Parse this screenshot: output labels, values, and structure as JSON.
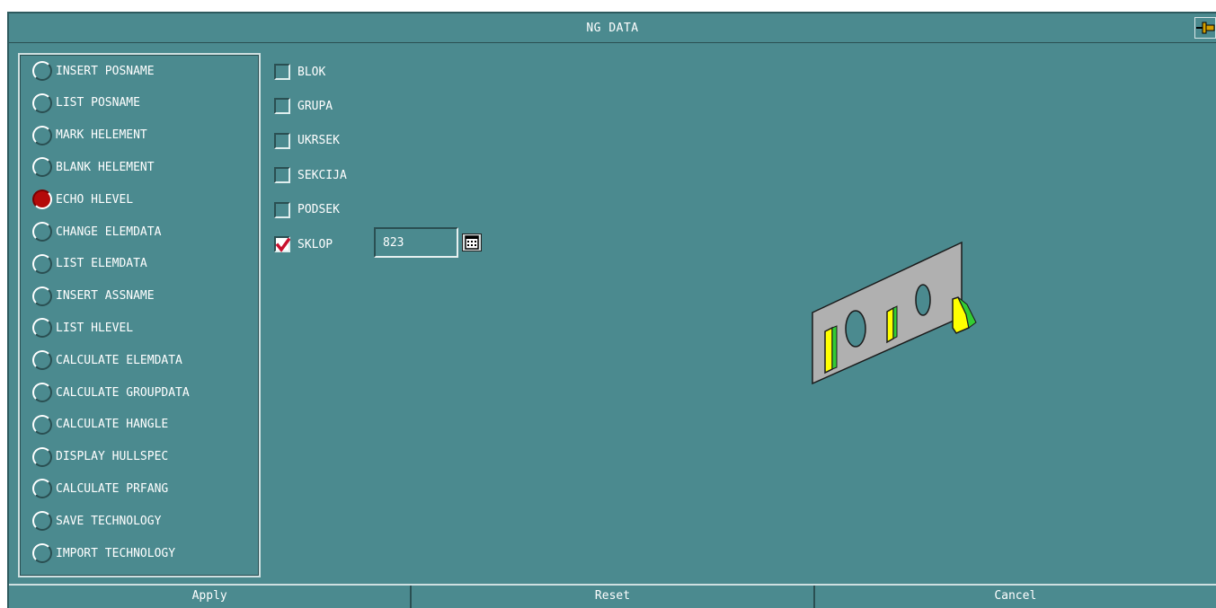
{
  "dialog": {
    "title": "NG DATA",
    "pin_icon": "pin-icon"
  },
  "functions": [
    {
      "label": "INSERT POSNAME",
      "selected": false
    },
    {
      "label": "LIST POSNAME",
      "selected": false
    },
    {
      "label": "MARK HELEMENT",
      "selected": false
    },
    {
      "label": "BLANK HELEMENT",
      "selected": false
    },
    {
      "label": "ECHO HLEVEL",
      "selected": true
    },
    {
      "label": "CHANGE ELEMDATA",
      "selected": false
    },
    {
      "label": "LIST ELEMDATA",
      "selected": false
    },
    {
      "label": "INSERT ASSNAME",
      "selected": false
    },
    {
      "label": "LIST HLEVEL",
      "selected": false
    },
    {
      "label": "CALCULATE ELEMDATA",
      "selected": false
    },
    {
      "label": "CALCULATE GROUPDATA",
      "selected": false
    },
    {
      "label": "CALCULATE HANGLE",
      "selected": false
    },
    {
      "label": "DISPLAY HULLSPEC",
      "selected": false
    },
    {
      "label": "CALCULATE PRFANG",
      "selected": false
    },
    {
      "label": "SAVE TECHNOLOGY",
      "selected": false
    },
    {
      "label": "IMPORT TECHNOLOGY",
      "selected": false
    }
  ],
  "levels": [
    {
      "label": "BLOK",
      "checked": false
    },
    {
      "label": "GRUPA",
      "checked": false
    },
    {
      "label": "UKRSEK",
      "checked": false
    },
    {
      "label": "SEKCIJA",
      "checked": false
    },
    {
      "label": "PODSEK",
      "checked": false
    },
    {
      "label": "SKLOP",
      "checked": true
    }
  ],
  "sklop": {
    "value": "823",
    "picker_icon": "calendar-icon"
  },
  "colors": {
    "background": "#4b8a8f",
    "selected_radio": "#b40a0a",
    "check_mark": "#c8102e",
    "part_yellow": "#ffff00",
    "part_green": "#33cc33",
    "plate": "#b0b0b0"
  },
  "buttons": {
    "apply": "Apply",
    "reset": "Reset",
    "cancel": "Cancel"
  }
}
